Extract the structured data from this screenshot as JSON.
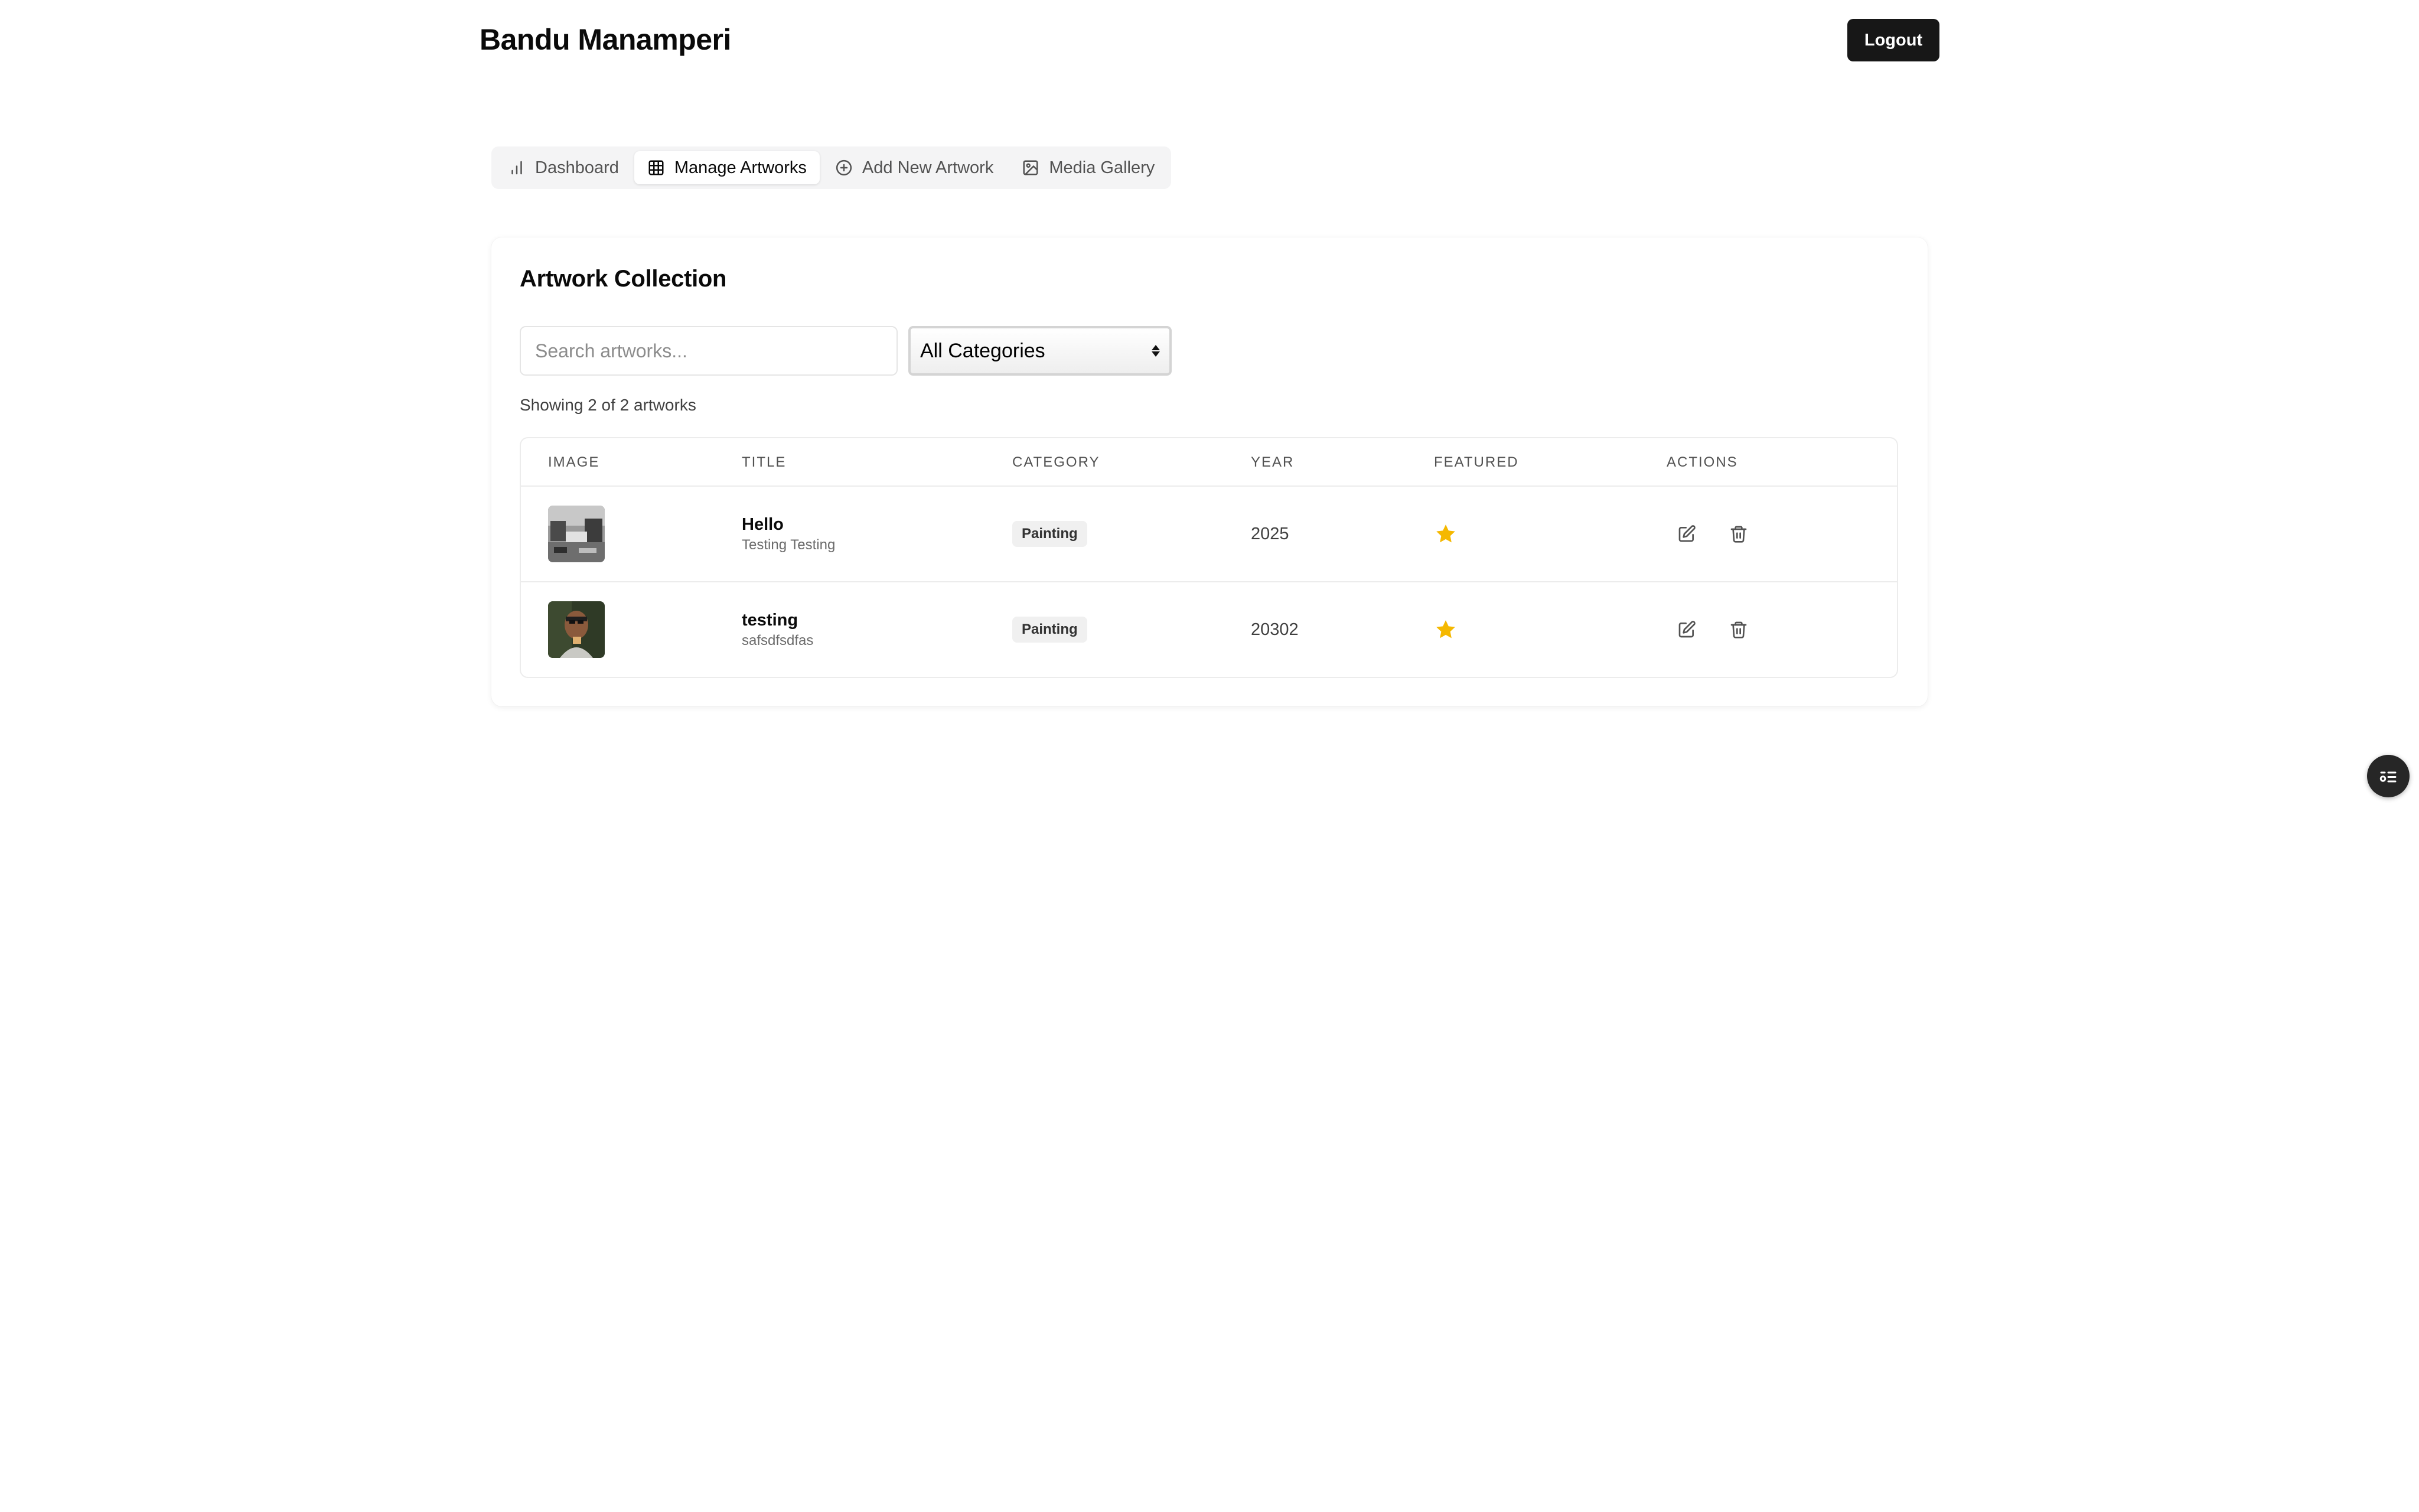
{
  "header": {
    "site_title": "Bandu Manamperi",
    "logout_label": "Logout"
  },
  "tabs": [
    {
      "label": "Dashboard",
      "icon": "bar-chart-icon",
      "active": false
    },
    {
      "label": "Manage Artworks",
      "icon": "table-grid-icon",
      "active": true
    },
    {
      "label": "Add New Artwork",
      "icon": "plus-circle-icon",
      "active": false
    },
    {
      "label": "Media Gallery",
      "icon": "image-icon",
      "active": false
    }
  ],
  "collection": {
    "title": "Artwork Collection",
    "search_placeholder": "Search artworks...",
    "category_selected": "All Categories",
    "showing_text": "Showing 2 of 2 artworks",
    "columns": [
      "Image",
      "Title",
      "Category",
      "Year",
      "Featured",
      "Actions"
    ],
    "rows": [
      {
        "title": "Hello",
        "subtitle": "Testing Testing",
        "category": "Painting",
        "year": "2025",
        "featured": true,
        "thumbnail": "grayscale-street-photo"
      },
      {
        "title": "testing",
        "subtitle": "safsdfsdfas",
        "category": "Painting",
        "year": "20302",
        "featured": true,
        "thumbnail": "portrait-photo"
      }
    ]
  },
  "colors": {
    "primary": "#171717",
    "star": "#f5b800",
    "tab_bg": "#f4f4f5",
    "border": "#ececec"
  },
  "floating_button_icon": "toggle-list-icon"
}
